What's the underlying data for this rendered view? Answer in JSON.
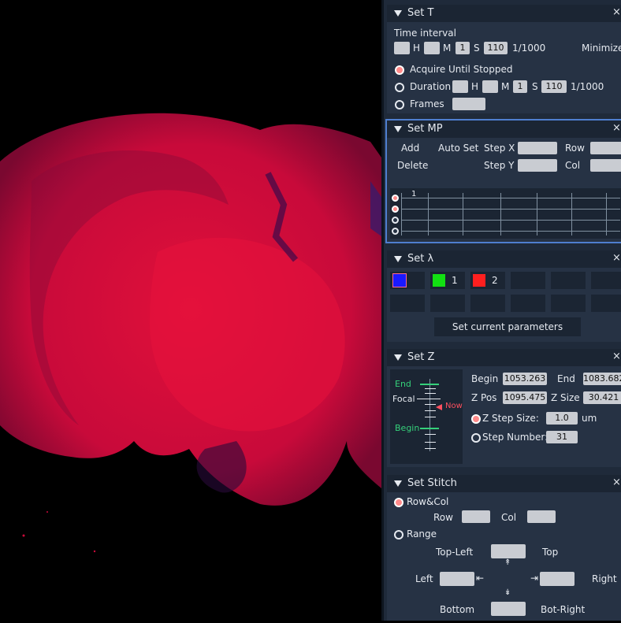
{
  "set_t": {
    "title": "Set T",
    "close": "×",
    "time_interval": "Time interval",
    "h": "H",
    "m": "M",
    "s": "S",
    "m_val": "1",
    "s_val": "110",
    "unit": "1/1000",
    "minimize": "Minimize",
    "acquire": "Acquire Until Stopped",
    "duration": "Duration",
    "dur_m_val": "1",
    "dur_s_val": "110",
    "frames": "Frames"
  },
  "set_mp": {
    "title": "Set MP",
    "close": "×",
    "add": "Add",
    "auto_set": "Auto Set",
    "step_x": "Step X",
    "row": "Row",
    "delete": "Delete",
    "step_y": "Step Y",
    "col": "Col",
    "row_num": "1"
  },
  "set_lambda": {
    "title": "Set λ",
    "close": "×",
    "ch1": "1",
    "ch2": "2",
    "set_current": "Set current parameters",
    "colors": {
      "blue": "#1a1aff",
      "green": "#12e012",
      "red": "#ff1f1f"
    }
  },
  "set_z": {
    "title": "Set Z",
    "close": "×",
    "end_lbl": "End",
    "focal_lbl": "Focal",
    "now_lbl": "Now",
    "begin_lbl": "Begin",
    "begin": "Begin",
    "begin_val": "1053.263",
    "end": "End",
    "end_val": "1083.682",
    "z_pos": "Z Pos",
    "z_pos_val": "1095.475",
    "z_size": "Z Size",
    "z_size_val": "30.421",
    "z_step": "Z Step Size:",
    "z_step_val": "1.0",
    "um": "um",
    "step_number": "Step Number:",
    "step_number_val": "31"
  },
  "set_stitch": {
    "title": "Set Stitch",
    "close": "×",
    "rowcol": "Row&Col",
    "row": "Row",
    "col": "Col",
    "range": "Range",
    "top_left": "Top-Left",
    "top": "Top",
    "left": "Left",
    "right": "Right",
    "bottom": "Bottom",
    "bot_right": "Bot-Right"
  }
}
